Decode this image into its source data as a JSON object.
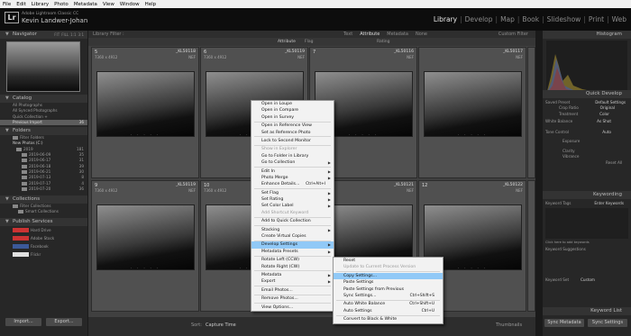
{
  "menubar": [
    "File",
    "Edit",
    "Library",
    "Photo",
    "Metadata",
    "View",
    "Window",
    "Help"
  ],
  "identity": {
    "logo": "Lr",
    "catalog_name": "Adobe Lightroom Classic CC",
    "user_name": "Kevin Landwer-Johan"
  },
  "modules": {
    "items": [
      "Library",
      "Develop",
      "Map",
      "Book",
      "Slideshow",
      "Print",
      "Web"
    ],
    "separator": "|",
    "active": "Library"
  },
  "navigator": {
    "title": "Navigator",
    "controls": [
      "FIT",
      "FILL",
      "1:1",
      "3:1"
    ]
  },
  "catalog": {
    "title": "Catalog",
    "items": [
      {
        "label": "All Photographs",
        "count": ""
      },
      {
        "label": "All Synced Photographs",
        "count": ""
      },
      {
        "label": "Quick Collection +",
        "count": ""
      },
      {
        "label": "Previous Import",
        "count": "36"
      }
    ]
  },
  "folders": {
    "title": "Folders",
    "filter": "Filter Folders",
    "volume": "New Photos (C:)",
    "items": [
      {
        "label": "2019",
        "count": "181"
      },
      {
        "label": "2019-06-09",
        "count": "35"
      },
      {
        "label": "2019-06-17",
        "count": "31"
      },
      {
        "label": "2019-06-18",
        "count": "39"
      },
      {
        "label": "2019-06-21",
        "count": "30"
      },
      {
        "label": "2019-07-13",
        "count": "8"
      },
      {
        "label": "2019-07-17",
        "count": "4"
      },
      {
        "label": "2019-07-20",
        "count": "36"
      }
    ]
  },
  "collections": {
    "title": "Collections",
    "filter": "Filter Collections",
    "items": [
      "Smart Collections"
    ]
  },
  "publish": {
    "title": "Publish Services",
    "items": [
      "Hard Drive",
      "Adobe Stock",
      "Facebook",
      "Flickr"
    ]
  },
  "left_buttons": {
    "import": "Import...",
    "export": "Export..."
  },
  "library_filter": {
    "title": "Library Filter :",
    "tabs": [
      "Text",
      "Attribute",
      "Metadata",
      "None"
    ],
    "active_tab": "Attribute",
    "preset": "Custom Filter"
  },
  "attribute_bar": {
    "label": "Attribute",
    "flag": "Flag",
    "rating": "Rating"
  },
  "grid": [
    {
      "num": "5",
      "dim": "7360 x 4912",
      "file": "_KL50118",
      "ext": "NEF"
    },
    {
      "num": "6",
      "dim": "7360 x 4912",
      "file": "_KL50119",
      "ext": "NEF"
    },
    {
      "num": "7",
      "dim": "",
      "file": "_KL50116",
      "ext": "NEF"
    },
    {
      "num": "",
      "dim": "",
      "file": "_KL50117",
      "ext": "NEF"
    },
    {
      "num": "",
      "dim": "",
      "file": "",
      "ext": ""
    },
    {
      "num": "9",
      "dim": "7360 x 4912",
      "file": "_KL50119",
      "ext": "NEF"
    },
    {
      "num": "10",
      "dim": "7360 x 4912",
      "file": "_KL50120",
      "ext": "NEF"
    },
    {
      "num": "11",
      "dim": "",
      "file": "_KL50121",
      "ext": "NEF"
    },
    {
      "num": "12",
      "dim": "",
      "file": "_KL50122",
      "ext": "NEF"
    },
    {
      "num": "",
      "dim": "",
      "file": "",
      "ext": ""
    }
  ],
  "context_menu": {
    "items": [
      {
        "label": "Open in Loupe"
      },
      {
        "label": "Open in Compare"
      },
      {
        "label": "Open in Survey"
      },
      {
        "sep": true
      },
      {
        "label": "Open in Reference View"
      },
      {
        "label": "Set as Reference Photo"
      },
      {
        "sep": true
      },
      {
        "label": "Lock to Second Monitor"
      },
      {
        "sep": true
      },
      {
        "label": "Show in Explorer",
        "disabled": true
      },
      {
        "label": "Go to Folder in Library"
      },
      {
        "label": "Go to Collection",
        "arrow": true
      },
      {
        "sep": true
      },
      {
        "label": "Edit In",
        "arrow": true
      },
      {
        "label": "Photo Merge",
        "arrow": true
      },
      {
        "label": "Enhance Details...",
        "shortcut": "Ctrl+Alt+I"
      },
      {
        "sep": true
      },
      {
        "label": "Set Flag",
        "arrow": true
      },
      {
        "label": "Set Rating",
        "arrow": true
      },
      {
        "label": "Set Color Label",
        "arrow": true
      },
      {
        "label": "Add Shortcut Keyword",
        "disabled": true
      },
      {
        "sep": true
      },
      {
        "label": "Add to Quick Collection"
      },
      {
        "sep": true
      },
      {
        "label": "Stacking",
        "arrow": true
      },
      {
        "label": "Create Virtual Copies"
      },
      {
        "sep": true
      },
      {
        "label": "Develop Settings",
        "arrow": true,
        "highlight": true
      },
      {
        "label": "Metadata Presets",
        "arrow": true
      },
      {
        "sep": true
      },
      {
        "label": "Rotate Left (CCW)"
      },
      {
        "label": "Rotate Right (CW)"
      },
      {
        "sep": true
      },
      {
        "label": "Metadata",
        "arrow": true
      },
      {
        "label": "Export",
        "arrow": true
      },
      {
        "sep": true
      },
      {
        "label": "Email Photos..."
      },
      {
        "sep": true
      },
      {
        "label": "Remove Photos..."
      },
      {
        "sep": true
      },
      {
        "label": "View Options..."
      }
    ]
  },
  "submenu": {
    "items": [
      {
        "label": "Reset"
      },
      {
        "label": "Update to Current Process Version",
        "disabled": true
      },
      {
        "sep": true
      },
      {
        "label": "Copy Settings...",
        "highlight": true
      },
      {
        "label": "Paste Settings"
      },
      {
        "label": "Paste Settings from Previous"
      },
      {
        "label": "Sync Settings...",
        "shortcut": "Ctrl+Shift+S"
      },
      {
        "sep": true
      },
      {
        "label": "Auto White Balance",
        "shortcut": "Ctrl+Shift+U"
      },
      {
        "label": "Auto Settings",
        "shortcut": "Ctrl+U"
      },
      {
        "sep": true
      },
      {
        "label": "Convert to Black & White"
      }
    ]
  },
  "right_panel": {
    "histogram": "Histogram",
    "quick_develop": "Quick Develop",
    "saved_preset_label": "Saved Preset",
    "saved_preset_value": "Default Settings",
    "crop_label": "Crop Ratio",
    "crop_value": "Original",
    "treatment_label": "Treatment",
    "treatment_value": "Color",
    "wb_label": "White Balance",
    "wb_value": "As Shot",
    "tone_label": "Tone Control",
    "tone_value": "Auto",
    "exposure": "Exposure",
    "clarity": "Clarity",
    "vibrance": "Vibrance",
    "reset": "Reset All",
    "keywording": "Keywording",
    "keyword_tags_label": "Keyword Tags",
    "keyword_tags_value": "Enter Keywords",
    "keyword_hint": "Click here to add keywords",
    "keyword_suggestions": "Keyword Suggestions",
    "keyword_set_label": "Keyword Set",
    "keyword_set_value": "Custom",
    "keyword_list": "Keyword List",
    "sync_metadata": "Sync Metadata",
    "sync_settings": "Sync Settings"
  },
  "toolbar": {
    "sort_label": "Sort:",
    "sort_value": "Capture Time",
    "thumbnails": "Thumbnails"
  }
}
